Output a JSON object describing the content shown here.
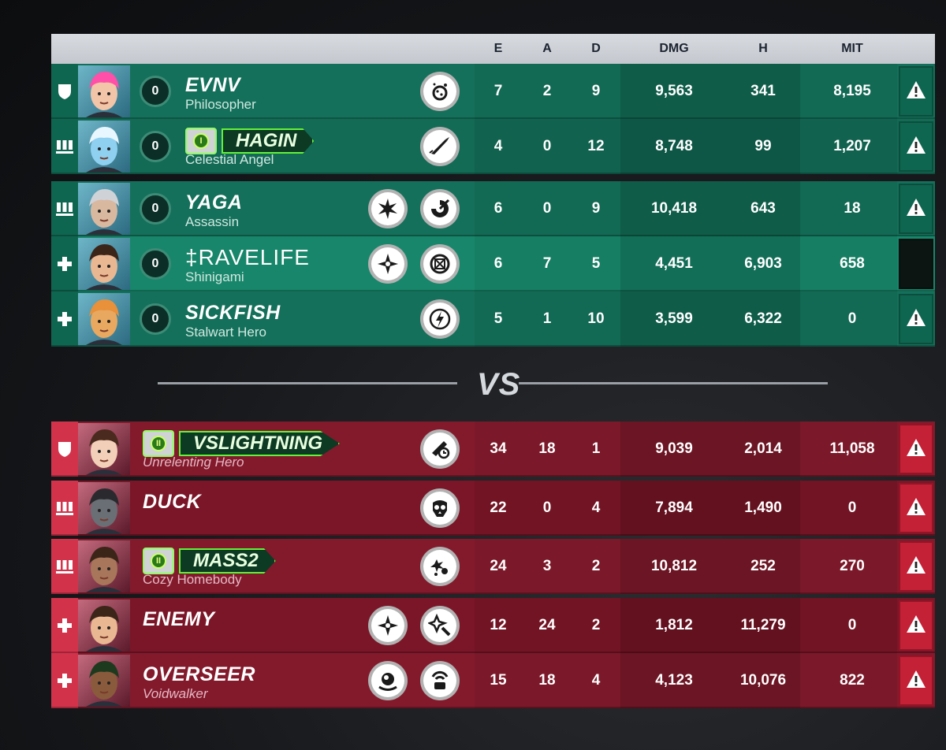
{
  "columns": [
    "E",
    "A",
    "D",
    "DMG",
    "H",
    "MIT"
  ],
  "vs_label": "VS",
  "team_a": [
    {
      "role": "tank",
      "rank": "0",
      "name": "EVNV",
      "title": "Philosopher",
      "E": "7",
      "A": "2",
      "D": "9",
      "DMG": "9,563",
      "H": "341",
      "MIT": "8,195",
      "ult_icons": [
        "dot-burst-icon"
      ],
      "report": "warning-icon"
    },
    {
      "role": "damage",
      "rank": "0",
      "name": "HAGIN",
      "title": "Celestial Angel",
      "badge": "I",
      "E": "4",
      "A": "0",
      "D": "12",
      "DMG": "8,748",
      "H": "99",
      "MIT": "1,207",
      "ult_icons": [
        "rocket-icon"
      ],
      "report": "warning-icon"
    },
    {
      "role": "damage",
      "rank": "0",
      "name": "YAGA",
      "title": "Assassin",
      "E": "6",
      "A": "0",
      "D": "9",
      "DMG": "10,418",
      "H": "643",
      "MIT": "18",
      "ult_icons": [
        "burst-icon",
        "swirl-icon"
      ],
      "report": "warning-icon"
    },
    {
      "role": "support",
      "rank": "0",
      "name": "‡RAVELIFE",
      "title": "Shinigami",
      "E": "6",
      "A": "7",
      "D": "5",
      "DMG": "4,451",
      "H": "6,903",
      "MIT": "658",
      "ult_icons": [
        "kunai-icon",
        "stop-icon"
      ],
      "report": "none",
      "self": true
    },
    {
      "role": "support",
      "rank": "0",
      "name": "SICKFISH",
      "title": "Stalwart Hero",
      "E": "5",
      "A": "1",
      "D": "10",
      "DMG": "3,599",
      "H": "6,322",
      "MIT": "0",
      "ult_icons": [
        "flame-icon"
      ],
      "report": "warning-icon"
    }
  ],
  "team_b": [
    {
      "role": "tank",
      "name": "VSLIGHTNING",
      "title": "Unrelenting Hero",
      "badge": "II",
      "E": "34",
      "A": "18",
      "D": "1",
      "DMG": "9,039",
      "H": "2,014",
      "MIT": "11,058",
      "ult_icons": [
        "boost-icon"
      ],
      "report": "warning-icon"
    },
    {
      "role": "damage",
      "name": "DUCK",
      "title": "",
      "E": "22",
      "A": "0",
      "D": "4",
      "DMG": "7,894",
      "H": "1,490",
      "MIT": "0",
      "ult_icons": [
        "skull-icon"
      ],
      "report": "warning-icon"
    },
    {
      "role": "damage",
      "name": "MASS2",
      "title": "Cozy Homebody",
      "badge": "II",
      "E": "24",
      "A": "3",
      "D": "2",
      "DMG": "10,812",
      "H": "252",
      "MIT": "270",
      "ult_icons": [
        "shots-icon"
      ],
      "report": "warning-icon"
    },
    {
      "role": "support",
      "name": "ENEMY",
      "title": "",
      "E": "12",
      "A": "24",
      "D": "2",
      "DMG": "1,812",
      "H": "11,279",
      "MIT": "0",
      "ult_icons": [
        "kunai-icon",
        "sparkle-icon"
      ],
      "report": "warning-icon"
    },
    {
      "role": "support",
      "name": "OVERSEER",
      "title": "Voidwalker",
      "E": "15",
      "A": "18",
      "D": "4",
      "DMG": "4,123",
      "H": "10,076",
      "MIT": "822",
      "ult_icons": [
        "orb-icon",
        "target-icon"
      ],
      "report": "warning-icon"
    }
  ]
}
